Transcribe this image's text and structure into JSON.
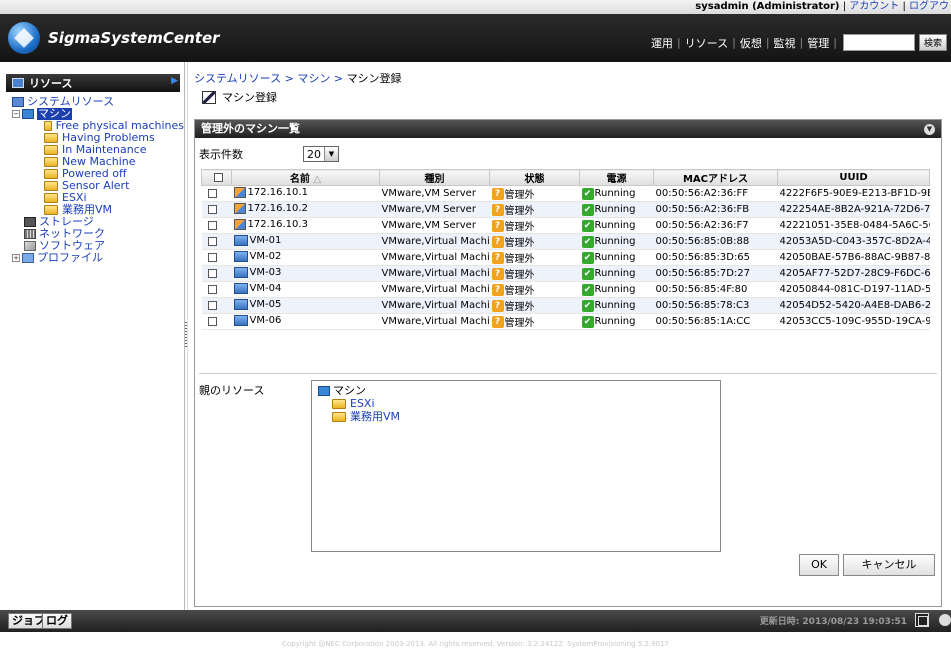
{
  "header": {
    "user": "sysadmin (Administrator)",
    "links": [
      "アカウント",
      "ログアウ"
    ],
    "logo": "SigmaSystemCenter",
    "nav": [
      "運用",
      "リソース",
      "仮想",
      "監視",
      "管理"
    ],
    "search_button": "検索",
    "search_value": ""
  },
  "sidebar": {
    "title": "リソース",
    "tree": {
      "root": "システムリソース",
      "machine": "マシン",
      "machine_children": [
        "Free physical machines",
        "Having Problems",
        "In Maintenance",
        "New Machine",
        "Powered off",
        "Sensor Alert",
        "ESXi",
        "業務用VM"
      ],
      "storage": "ストレージ",
      "network": "ネットワーク",
      "software": "ソフトウェア",
      "profile": "プロファイル"
    }
  },
  "main": {
    "breadcrumb": [
      "システムリソース",
      "マシン",
      "マシン登録"
    ],
    "page_title": "マシン登録",
    "panel_title": "管理外のマシン一覧",
    "count_label": "表示件数",
    "count_value": "20",
    "columns": [
      "名前",
      "種別",
      "状態",
      "電源",
      "MACアドレス",
      "UUID"
    ],
    "rows": [
      {
        "name": "172.16.10.1",
        "kind": "VMware,VM Server",
        "state": "管理外",
        "power": "Running",
        "mac": "00:50:56:A2:36:FF",
        "uuid": "4222F6F5-90E9-E213-BF1D-9E",
        "icon": "host"
      },
      {
        "name": "172.16.10.2",
        "kind": "VMware,VM Server",
        "state": "管理外",
        "power": "Running",
        "mac": "00:50:56:A2:36:FB",
        "uuid": "422254AE-8B2A-921A-72D6-7D",
        "icon": "host"
      },
      {
        "name": "172.16.10.3",
        "kind": "VMware,VM Server",
        "state": "管理外",
        "power": "Running",
        "mac": "00:50:56:A2:36:F7",
        "uuid": "42221051-35E8-0484-5A6C-565",
        "icon": "host"
      },
      {
        "name": "VM-01",
        "kind": "VMware,Virtual Machin",
        "state": "管理外",
        "power": "Running",
        "mac": "00:50:56:85:0B:88",
        "uuid": "42053A5D-C043-357C-8D2A-49",
        "icon": "vm"
      },
      {
        "name": "VM-02",
        "kind": "VMware,Virtual Machin",
        "state": "管理外",
        "power": "Running",
        "mac": "00:50:56:85:3D:65",
        "uuid": "42050BAE-57B6-88AC-9B87-8",
        "icon": "vm"
      },
      {
        "name": "VM-03",
        "kind": "VMware,Virtual Machin",
        "state": "管理外",
        "power": "Running",
        "mac": "00:50:56:85:7D:27",
        "uuid": "4205AF77-52D7-28C9-F6DC-6E",
        "icon": "vm"
      },
      {
        "name": "VM-04",
        "kind": "VMware,Virtual Machin",
        "state": "管理外",
        "power": "Running",
        "mac": "00:50:56:85:4F:80",
        "uuid": "42050844-081C-D197-11AD-5E",
        "icon": "vm"
      },
      {
        "name": "VM-05",
        "kind": "VMware,Virtual Machin",
        "state": "管理外",
        "power": "Running",
        "mac": "00:50:56:85:78:C3",
        "uuid": "42054D52-5420-A4E8-DAB6-23",
        "icon": "vm"
      },
      {
        "name": "VM-06",
        "kind": "VMware,Virtual Machin",
        "state": "管理外",
        "power": "Running",
        "mac": "00:50:56:85:1A:CC",
        "uuid": "42053CC5-109C-955D-19CA-9E",
        "icon": "vm"
      }
    ],
    "parent_label": "親のリソース",
    "parent_tree": {
      "root": "マシン",
      "children": [
        "ESXi",
        "業務用VM"
      ]
    },
    "ok": "OK",
    "cancel": "キャンセル"
  },
  "bottom": {
    "tabs": [
      "ジョブ",
      "ログ"
    ],
    "updated": "更新日時: 2013/08/23 19:03:51",
    "copyright": "Copyright @NEC Corporation 2003-2013. All rights reserved. Version: 3.2.24122. SystemProvisioning 5.2.9017"
  }
}
